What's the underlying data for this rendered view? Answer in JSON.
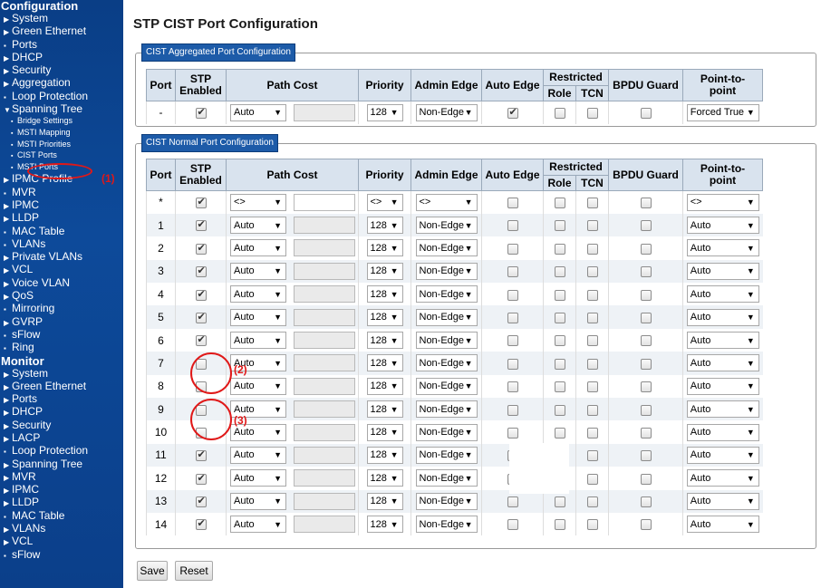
{
  "sidebar": {
    "config_heading": "Configuration",
    "config_items": [
      {
        "mark": "▶",
        "label": "System"
      },
      {
        "mark": "▶",
        "label": "Green Ethernet"
      },
      {
        "mark": "▪",
        "label": "Ports"
      },
      {
        "mark": "▶",
        "label": "DHCP"
      },
      {
        "mark": "▶",
        "label": "Security"
      },
      {
        "mark": "▶",
        "label": "Aggregation"
      },
      {
        "mark": "▪",
        "label": "Loop Protection"
      },
      {
        "mark": "▼",
        "label": "Spanning Tree"
      }
    ],
    "stp_sub": [
      {
        "mark": "▪",
        "label": "Bridge Settings"
      },
      {
        "mark": "▪",
        "label": "MSTI Mapping"
      },
      {
        "mark": "▪",
        "label": "MSTI Priorities"
      },
      {
        "mark": "▪",
        "label": "CIST Ports"
      },
      {
        "mark": "▪",
        "label": "MSTI Ports"
      }
    ],
    "config_items2": [
      {
        "mark": "▶",
        "label": "IPMC Profile"
      },
      {
        "mark": "▪",
        "label": "MVR"
      },
      {
        "mark": "▶",
        "label": "IPMC"
      },
      {
        "mark": "▶",
        "label": "LLDP"
      },
      {
        "mark": "▪",
        "label": "MAC Table"
      },
      {
        "mark": "▪",
        "label": "VLANs"
      },
      {
        "mark": "▶",
        "label": "Private VLANs"
      },
      {
        "mark": "▶",
        "label": "VCL"
      },
      {
        "mark": "▶",
        "label": "Voice VLAN"
      },
      {
        "mark": "▶",
        "label": "QoS"
      },
      {
        "mark": "▪",
        "label": "Mirroring"
      },
      {
        "mark": "▶",
        "label": "GVRP"
      },
      {
        "mark": "▪",
        "label": "sFlow"
      },
      {
        "mark": "▪",
        "label": "Ring"
      }
    ],
    "monitor_heading": "Monitor",
    "monitor_items": [
      {
        "mark": "▶",
        "label": "System"
      },
      {
        "mark": "▶",
        "label": "Green Ethernet"
      },
      {
        "mark": "▶",
        "label": "Ports"
      },
      {
        "mark": "▶",
        "label": "DHCP"
      },
      {
        "mark": "▶",
        "label": "Security"
      },
      {
        "mark": "▶",
        "label": "LACP"
      },
      {
        "mark": "▪",
        "label": "Loop Protection"
      },
      {
        "mark": "▶",
        "label": "Spanning Tree"
      },
      {
        "mark": "▶",
        "label": "MVR"
      },
      {
        "mark": "▶",
        "label": "IPMC"
      },
      {
        "mark": "▶",
        "label": "LLDP"
      },
      {
        "mark": "▪",
        "label": "MAC Table"
      },
      {
        "mark": "▶",
        "label": "VLANs"
      },
      {
        "mark": "▶",
        "label": "VCL"
      },
      {
        "mark": "▪",
        "label": "sFlow"
      }
    ]
  },
  "annotations": {
    "a1": "(1)",
    "a2": "(2)",
    "a3": "(3)"
  },
  "page_title": "STP CIST Port Configuration",
  "agg": {
    "legend": "CIST Aggregated Port Configuration",
    "row": {
      "port": "-",
      "stp": true,
      "path_cost": "Auto",
      "priority": "128",
      "admin_edge": "Non-Edge",
      "auto_edge": true,
      "role": false,
      "tcn": false,
      "bpdu": false,
      "p2p": "Forced True"
    }
  },
  "normal": {
    "legend": "CIST Normal Port Configuration",
    "rows": [
      {
        "port": "*",
        "stp": true,
        "path_cost": "<>",
        "priority": "<>",
        "admin_edge": "<>",
        "auto_edge": false,
        "role": false,
        "tcn": false,
        "bpdu": false,
        "p2p": "<>"
      },
      {
        "port": "1",
        "stp": true,
        "path_cost": "Auto",
        "priority": "128",
        "admin_edge": "Non-Edge",
        "auto_edge": false,
        "role": false,
        "tcn": false,
        "bpdu": false,
        "p2p": "Auto"
      },
      {
        "port": "2",
        "stp": true,
        "path_cost": "Auto",
        "priority": "128",
        "admin_edge": "Non-Edge",
        "auto_edge": false,
        "role": false,
        "tcn": false,
        "bpdu": false,
        "p2p": "Auto"
      },
      {
        "port": "3",
        "stp": true,
        "path_cost": "Auto",
        "priority": "128",
        "admin_edge": "Non-Edge",
        "auto_edge": false,
        "role": false,
        "tcn": false,
        "bpdu": false,
        "p2p": "Auto"
      },
      {
        "port": "4",
        "stp": true,
        "path_cost": "Auto",
        "priority": "128",
        "admin_edge": "Non-Edge",
        "auto_edge": false,
        "role": false,
        "tcn": false,
        "bpdu": false,
        "p2p": "Auto"
      },
      {
        "port": "5",
        "stp": true,
        "path_cost": "Auto",
        "priority": "128",
        "admin_edge": "Non-Edge",
        "auto_edge": false,
        "role": false,
        "tcn": false,
        "bpdu": false,
        "p2p": "Auto"
      },
      {
        "port": "6",
        "stp": true,
        "path_cost": "Auto",
        "priority": "128",
        "admin_edge": "Non-Edge",
        "auto_edge": false,
        "role": false,
        "tcn": false,
        "bpdu": false,
        "p2p": "Auto"
      },
      {
        "port": "7",
        "stp": false,
        "path_cost": "Auto",
        "priority": "128",
        "admin_edge": "Non-Edge",
        "auto_edge": false,
        "role": false,
        "tcn": false,
        "bpdu": false,
        "p2p": "Auto"
      },
      {
        "port": "8",
        "stp": false,
        "path_cost": "Auto",
        "priority": "128",
        "admin_edge": "Non-Edge",
        "auto_edge": false,
        "role": false,
        "tcn": false,
        "bpdu": false,
        "p2p": "Auto"
      },
      {
        "port": "9",
        "stp": false,
        "path_cost": "Auto",
        "priority": "128",
        "admin_edge": "Non-Edge",
        "auto_edge": false,
        "role": false,
        "tcn": false,
        "bpdu": false,
        "p2p": "Auto"
      },
      {
        "port": "10",
        "stp": false,
        "path_cost": "Auto",
        "priority": "128",
        "admin_edge": "Non-Edge",
        "auto_edge": false,
        "role": false,
        "tcn": false,
        "bpdu": false,
        "p2p": "Auto"
      },
      {
        "port": "11",
        "stp": true,
        "path_cost": "Auto",
        "priority": "128",
        "admin_edge": "Non-Edge",
        "auto_edge": false,
        "role": false,
        "tcn": false,
        "bpdu": false,
        "p2p": "Auto"
      },
      {
        "port": "12",
        "stp": true,
        "path_cost": "Auto",
        "priority": "128",
        "admin_edge": "Non-Edge",
        "auto_edge": false,
        "role": false,
        "tcn": false,
        "bpdu": false,
        "p2p": "Auto"
      },
      {
        "port": "13",
        "stp": true,
        "path_cost": "Auto",
        "priority": "128",
        "admin_edge": "Non-Edge",
        "auto_edge": false,
        "role": false,
        "tcn": false,
        "bpdu": false,
        "p2p": "Auto"
      },
      {
        "port": "14",
        "stp": true,
        "path_cost": "Auto",
        "priority": "128",
        "admin_edge": "Non-Edge",
        "auto_edge": false,
        "role": false,
        "tcn": false,
        "bpdu": false,
        "p2p": "Auto"
      }
    ]
  },
  "headers": {
    "port": "Port",
    "stp": "STP",
    "stp2": "Enabled",
    "path_cost": "Path Cost",
    "priority": "Priority",
    "admin_edge": "Admin Edge",
    "auto_edge": "Auto Edge",
    "restricted": "Restricted",
    "role": "Role",
    "tcn": "TCN",
    "bpdu": "BPDU Guard",
    "p2p": "Point-to-",
    "p2p2": "point"
  },
  "buttons": {
    "save": "Save",
    "reset": "Reset"
  }
}
